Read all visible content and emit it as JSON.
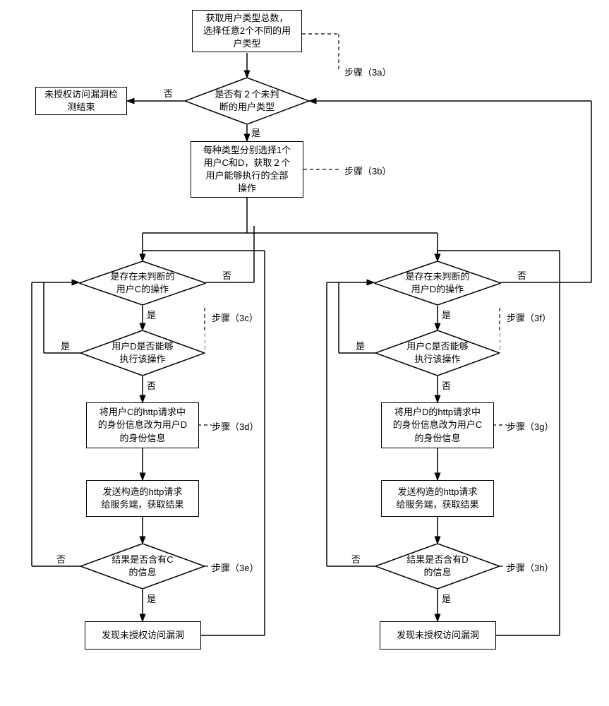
{
  "nodes": {
    "start": "获取用户类型总数，\n选择任意2个不同的用\n户类型",
    "end": "未授权访问漏洞检\n测结束",
    "dec_types": "是否有２个未判\n断的用户类型",
    "step3b": "每种类型分别选择1个\n用户C和D，获取２个\n用户能够执行的全部\n操作",
    "dec_c_ops": "是存在未判断的\n用户C的操作",
    "dec_d_can": "用户D是否能够\n执行该操作",
    "box_3d": "将用户C的http请求中\n的身份信息改为用户D\n的身份信息",
    "box_send_c": "发送构造的http请求\n给服务端，获取结果",
    "dec_result_c": "结果是否含有C\n的信息",
    "found_c": "发现未授权访问漏洞",
    "dec_d_ops": "是存在未判断的\n用户D的操作",
    "dec_c_can": "用户C是否能够\n执行该操作",
    "box_3g": "将用户D的http请求中\n的身份信息改为用户C\n的身份信息",
    "box_send_d": "发送构造的http请求\n给服务端，获取结果",
    "dec_result_d": "结果是否含有D\n的信息",
    "found_d": "发现未授权访问漏洞"
  },
  "labels": {
    "yes": "是",
    "no": "否",
    "step3a": "步骤（3a）",
    "step3b": "步骤（3b）",
    "step3c": "步骤（3c）",
    "step3d": "步骤（3d）",
    "step3e": "步骤（3e）",
    "step3f": "步骤（3f）",
    "step3g": "步骤（3g）",
    "step3h": "步骤（3h）"
  }
}
